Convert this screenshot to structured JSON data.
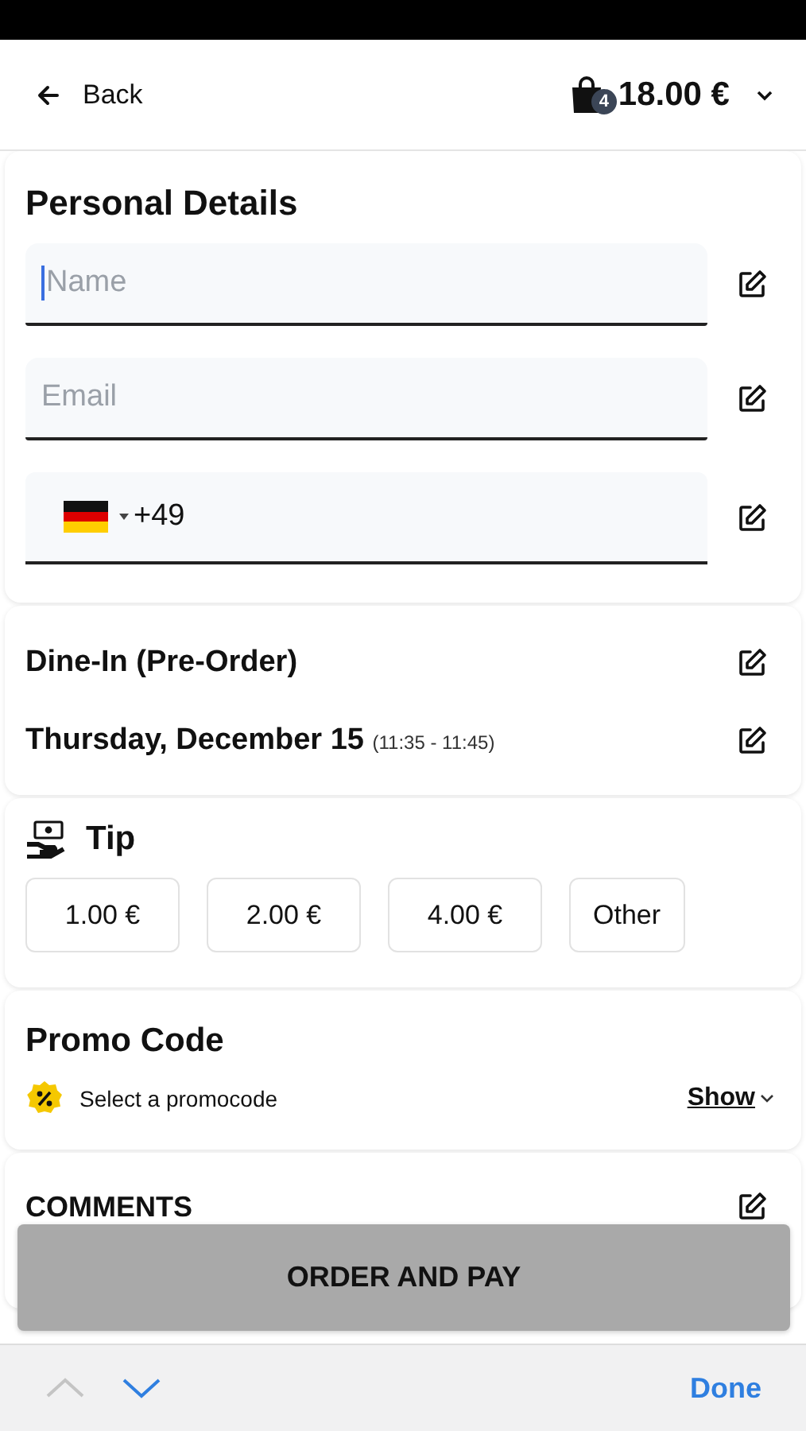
{
  "header": {
    "back_label": "Back",
    "cart_count": "4",
    "cart_total": "18.00 €"
  },
  "personal_details": {
    "title": "Personal Details",
    "fields": [
      {
        "kind": "text",
        "placeholder": "Name",
        "focused": true
      },
      {
        "kind": "text",
        "placeholder": "Email",
        "focused": false
      },
      {
        "kind": "phone",
        "value": "+49",
        "focused": false
      }
    ]
  },
  "order_type": {
    "mode": "Dine-In (Pre-Order)",
    "date": "Thursday, December 15",
    "time": "(11:35 - 11:45)"
  },
  "tip": {
    "title": "Tip",
    "options": [
      {
        "label": "1.00 €",
        "selected": false
      },
      {
        "label": "2.00 €",
        "selected": false
      },
      {
        "label": "4.00 €",
        "selected": false
      },
      {
        "label": "Other",
        "selected": false
      }
    ]
  },
  "promo": {
    "title": "Promo Code",
    "label": "Select a promocode",
    "toggle": "Show"
  },
  "comments": {
    "title": "COMMENTS"
  },
  "order_button": {
    "label": "ORDER AND PAY"
  },
  "keyboard_toolbar": {
    "previous_enabled": false,
    "next_enabled": true,
    "done": "Done"
  }
}
